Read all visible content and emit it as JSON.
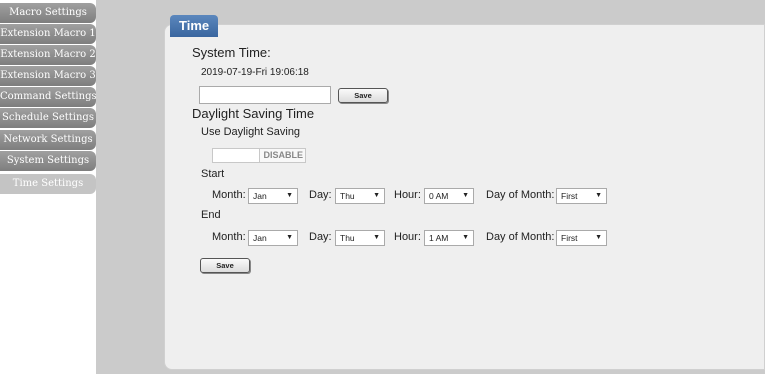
{
  "sidebar": {
    "items": [
      {
        "label": "Macro Settings"
      },
      {
        "label": "Extension Macro 1"
      },
      {
        "label": "Extension Macro 2"
      },
      {
        "label": "Extension Macro 3"
      },
      {
        "label": "Command Settings"
      },
      {
        "label": "Schedule Settings"
      },
      {
        "label": "Network Settings"
      },
      {
        "label": "System Settings"
      },
      {
        "label": "Time Settings",
        "active": true
      }
    ]
  },
  "panel": {
    "tab_label": "Time",
    "system_time": {
      "heading": "System Time:",
      "current": "2019-07-19-Fri 19:06:18",
      "input_value": "",
      "save_label": "Save"
    },
    "dst": {
      "heading": "Daylight Saving Time",
      "use_label": "Use Daylight Saving",
      "toggle_state": "DISABLE",
      "start": {
        "heading": "Start",
        "month_label": "Month:",
        "month_value": "Jan",
        "day_label": "Day:",
        "day_value": "Thu",
        "hour_label": "Hour:",
        "hour_value": "0 AM",
        "dom_label": "Day of Month:",
        "dom_value": "First"
      },
      "end": {
        "heading": "End",
        "month_label": "Month:",
        "month_value": "Jan",
        "day_label": "Day:",
        "day_value": "Thu",
        "hour_label": "Hour:",
        "hour_value": "1 AM",
        "dom_label": "Day of Month:",
        "dom_value": "First"
      },
      "save_label": "Save"
    }
  },
  "icons": {
    "dropdown": "chevron-down-icon",
    "arrow_glyph": "▼"
  },
  "colors": {
    "tab_blue": "#3a669f",
    "nav_gray": "#8c8c8c",
    "nav_active": "#c4c4c4",
    "panel_bg": "#efefef",
    "page_bg": "#cbcbcb"
  }
}
